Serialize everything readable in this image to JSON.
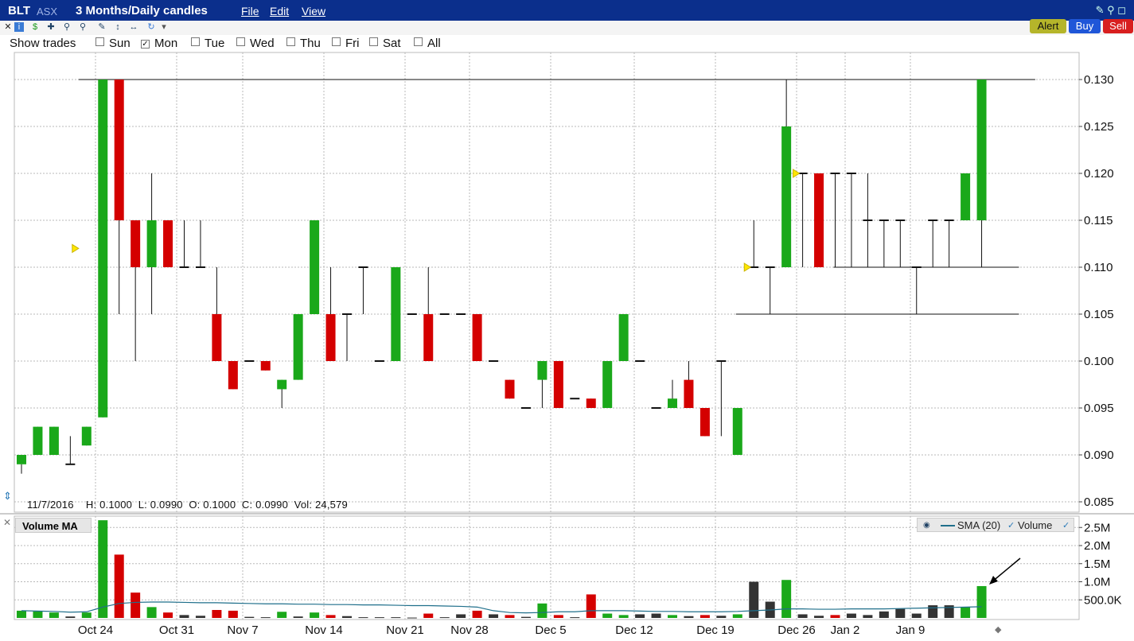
{
  "header": {
    "symbol": "BLT",
    "exchange": "ASX",
    "period": "3 Months/Daily candles",
    "menus": [
      "File",
      "Edit",
      "View"
    ]
  },
  "buttons": {
    "alert": "Alert",
    "buy": "Buy",
    "sell": "Sell"
  },
  "show_trades": {
    "label": "Show trades",
    "days": [
      {
        "label": "Sun",
        "checked": false
      },
      {
        "label": "Mon",
        "checked": true
      },
      {
        "label": "Tue",
        "checked": false
      },
      {
        "label": "Wed",
        "checked": false
      },
      {
        "label": "Thu",
        "checked": false
      },
      {
        "label": "Fri",
        "checked": false
      },
      {
        "label": "Sat",
        "checked": false
      },
      {
        "label": "All",
        "checked": false
      }
    ]
  },
  "info_bar": "11/7/2016    H: 0.1000  L: 0.0990  O: 0.1000  C: 0.0990  Vol: 24,579",
  "volume_panel": {
    "title": "Volume MA",
    "legend_sma": "SMA (20)",
    "legend_volume": "Volume"
  },
  "colors": {
    "up": "#1aa81a",
    "down": "#d40000",
    "neutral": "#333333",
    "sma": "#1f6f8b",
    "header": "#0b2f8c"
  },
  "chart_data": {
    "type": "candlestick",
    "x_labels": [
      "Oct 24",
      "Oct 31",
      "Nov 7",
      "Nov 14",
      "Nov 21",
      "Nov 28",
      "Dec 5",
      "Dec 12",
      "Dec 19",
      "Dec 26",
      "Jan 2",
      "Jan 9"
    ],
    "y_ticks": [
      "0.130",
      "0.125",
      "0.120",
      "0.115",
      "0.110",
      "0.105",
      "0.100",
      "0.095",
      "0.090",
      "0.085"
    ],
    "ylim": [
      0.085,
      0.13
    ],
    "volume_ticks": [
      "2.5M",
      "2.0M",
      "1.5M",
      "1.0M",
      "500.0K"
    ],
    "volume_ylim": [
      0,
      2.7
    ],
    "candles": [
      {
        "o": 0.089,
        "h": 0.089,
        "l": 0.088,
        "c": 0.09,
        "v": 0.2
      },
      {
        "o": 0.09,
        "h": 0.093,
        "l": 0.09,
        "c": 0.093,
        "v": 0.18
      },
      {
        "o": 0.09,
        "h": 0.093,
        "l": 0.09,
        "c": 0.093,
        "v": 0.15
      },
      {
        "o": 0.089,
        "h": 0.092,
        "l": 0.089,
        "c": 0.089,
        "v": 0.04
      },
      {
        "o": 0.091,
        "h": 0.093,
        "l": 0.091,
        "c": 0.093,
        "v": 0.15
      },
      {
        "o": 0.094,
        "h": 0.13,
        "l": 0.094,
        "c": 0.13,
        "v": 2.7
      },
      {
        "o": 0.13,
        "h": 0.13,
        "l": 0.105,
        "c": 0.115,
        "v": 1.75
      },
      {
        "o": 0.115,
        "h": 0.115,
        "l": 0.1,
        "c": 0.11,
        "v": 0.7
      },
      {
        "o": 0.11,
        "h": 0.12,
        "l": 0.105,
        "c": 0.115,
        "v": 0.3
      },
      {
        "o": 0.115,
        "h": 0.115,
        "l": 0.11,
        "c": 0.11,
        "v": 0.15
      },
      {
        "o": 0.11,
        "h": 0.115,
        "l": 0.11,
        "c": 0.11,
        "v": 0.08
      },
      {
        "o": 0.11,
        "h": 0.115,
        "l": 0.11,
        "c": 0.11,
        "v": 0.06
      },
      {
        "o": 0.105,
        "h": 0.11,
        "l": 0.1,
        "c": 0.1,
        "v": 0.22
      },
      {
        "o": 0.1,
        "h": 0.1,
        "l": 0.097,
        "c": 0.097,
        "v": 0.2
      },
      {
        "o": 0.1,
        "h": 0.1,
        "l": 0.1,
        "c": 0.1,
        "v": 0.03
      },
      {
        "o": 0.1,
        "h": 0.1,
        "l": 0.099,
        "c": 0.099,
        "v": 0.02
      },
      {
        "o": 0.097,
        "h": 0.098,
        "l": 0.095,
        "c": 0.098,
        "v": 0.17
      },
      {
        "o": 0.098,
        "h": 0.105,
        "l": 0.098,
        "c": 0.105,
        "v": 0.04
      },
      {
        "o": 0.105,
        "h": 0.115,
        "l": 0.105,
        "c": 0.115,
        "v": 0.15
      },
      {
        "o": 0.105,
        "h": 0.11,
        "l": 0.1,
        "c": 0.1,
        "v": 0.08
      },
      {
        "o": 0.105,
        "h": 0.105,
        "l": 0.1,
        "c": 0.105,
        "v": 0.05
      },
      {
        "o": 0.11,
        "h": 0.11,
        "l": 0.105,
        "c": 0.11,
        "v": 0.02
      },
      {
        "o": 0.1,
        "h": 0.1,
        "l": 0.1,
        "c": 0.1,
        "v": 0.02
      },
      {
        "o": 0.1,
        "h": 0.11,
        "l": 0.1,
        "c": 0.11,
        "v": 0.02
      },
      {
        "o": 0.105,
        "h": 0.105,
        "l": 0.105,
        "c": 0.105,
        "v": 0.01
      },
      {
        "o": 0.105,
        "h": 0.11,
        "l": 0.1,
        "c": 0.1,
        "v": 0.12
      },
      {
        "o": 0.105,
        "h": 0.105,
        "l": 0.105,
        "c": 0.105,
        "v": 0.02
      },
      {
        "o": 0.105,
        "h": 0.105,
        "l": 0.105,
        "c": 0.105,
        "v": 0.1
      },
      {
        "o": 0.105,
        "h": 0.105,
        "l": 0.1,
        "c": 0.1,
        "v": 0.2
      },
      {
        "o": 0.1,
        "h": 0.1,
        "l": 0.1,
        "c": 0.1,
        "v": 0.1
      },
      {
        "o": 0.098,
        "h": 0.098,
        "l": 0.096,
        "c": 0.096,
        "v": 0.08
      },
      {
        "o": 0.095,
        "h": 0.095,
        "l": 0.095,
        "c": 0.095,
        "v": 0.03
      },
      {
        "o": 0.098,
        "h": 0.1,
        "l": 0.095,
        "c": 0.1,
        "v": 0.4
      },
      {
        "o": 0.1,
        "h": 0.1,
        "l": 0.095,
        "c": 0.095,
        "v": 0.08
      },
      {
        "o": 0.096,
        "h": 0.096,
        "l": 0.096,
        "c": 0.096,
        "v": 0.02
      },
      {
        "o": 0.096,
        "h": 0.096,
        "l": 0.095,
        "c": 0.095,
        "v": 0.65
      },
      {
        "o": 0.095,
        "h": 0.1,
        "l": 0.095,
        "c": 0.1,
        "v": 0.12
      },
      {
        "o": 0.1,
        "h": 0.105,
        "l": 0.1,
        "c": 0.105,
        "v": 0.08
      },
      {
        "o": 0.1,
        "h": 0.1,
        "l": 0.1,
        "c": 0.1,
        "v": 0.1
      },
      {
        "o": 0.095,
        "h": 0.095,
        "l": 0.095,
        "c": 0.095,
        "v": 0.12
      },
      {
        "o": 0.095,
        "h": 0.098,
        "l": 0.095,
        "c": 0.096,
        "v": 0.08
      },
      {
        "o": 0.098,
        "h": 0.1,
        "l": 0.095,
        "c": 0.095,
        "v": 0.05
      },
      {
        "o": 0.095,
        "h": 0.095,
        "l": 0.092,
        "c": 0.092,
        "v": 0.08
      },
      {
        "o": 0.1,
        "h": 0.1,
        "l": 0.092,
        "c": 0.1,
        "v": 0.06
      },
      {
        "o": 0.09,
        "h": 0.095,
        "l": 0.09,
        "c": 0.095,
        "v": 0.1
      },
      {
        "o": 0.11,
        "h": 0.115,
        "l": 0.11,
        "c": 0.11,
        "v": 1.0
      },
      {
        "o": 0.11,
        "h": 0.11,
        "l": 0.105,
        "c": 0.11,
        "v": 0.45
      },
      {
        "o": 0.11,
        "h": 0.13,
        "l": 0.11,
        "c": 0.125,
        "v": 1.05
      },
      {
        "o": 0.12,
        "h": 0.12,
        "l": 0.11,
        "c": 0.12,
        "v": 0.1
      },
      {
        "o": 0.12,
        "h": 0.12,
        "l": 0.11,
        "c": 0.11,
        "v": 0.06
      },
      {
        "o": 0.12,
        "h": 0.12,
        "l": 0.11,
        "c": 0.12,
        "v": 0.08
      },
      {
        "o": 0.12,
        "h": 0.12,
        "l": 0.11,
        "c": 0.12,
        "v": 0.12
      },
      {
        "o": 0.115,
        "h": 0.12,
        "l": 0.11,
        "c": 0.115,
        "v": 0.08
      },
      {
        "o": 0.115,
        "h": 0.115,
        "l": 0.11,
        "c": 0.115,
        "v": 0.18
      },
      {
        "o": 0.115,
        "h": 0.115,
        "l": 0.11,
        "c": 0.115,
        "v": 0.25
      },
      {
        "o": 0.11,
        "h": 0.11,
        "l": 0.105,
        "c": 0.11,
        "v": 0.12
      },
      {
        "o": 0.115,
        "h": 0.115,
        "l": 0.11,
        "c": 0.115,
        "v": 0.35
      },
      {
        "o": 0.115,
        "h": 0.115,
        "l": 0.11,
        "c": 0.115,
        "v": 0.35
      },
      {
        "o": 0.115,
        "h": 0.12,
        "l": 0.115,
        "c": 0.12,
        "v": 0.3
      },
      {
        "o": 0.115,
        "h": 0.13,
        "l": 0.11,
        "c": 0.13,
        "v": 0.88
      }
    ],
    "volume_colors": [
      "up",
      "up",
      "up",
      "neutral",
      "up",
      "up",
      "down",
      "down",
      "up",
      "down",
      "neutral",
      "neutral",
      "down",
      "down",
      "neutral",
      "neutral",
      "up",
      "neutral",
      "up",
      "down",
      "neutral",
      "neutral",
      "neutral",
      "neutral",
      "neutral",
      "down",
      "neutral",
      "neutral",
      "down",
      "neutral",
      "down",
      "neutral",
      "up",
      "down",
      "neutral",
      "down",
      "up",
      "up",
      "neutral",
      "neutral",
      "up",
      "neutral",
      "down",
      "neutral",
      "up",
      "neutral",
      "neutral",
      "up",
      "neutral",
      "neutral",
      "down",
      "neutral",
      "neutral",
      "neutral",
      "neutral",
      "neutral",
      "neutral",
      "neutral",
      "up",
      "up"
    ],
    "sma20": [
      0.2,
      0.19,
      0.18,
      0.16,
      0.17,
      0.3,
      0.4,
      0.43,
      0.44,
      0.44,
      0.43,
      0.42,
      0.42,
      0.41,
      0.4,
      0.39,
      0.39,
      0.38,
      0.38,
      0.37,
      0.37,
      0.36,
      0.36,
      0.35,
      0.34,
      0.34,
      0.33,
      0.32,
      0.3,
      0.2,
      0.15,
      0.14,
      0.15,
      0.17,
      0.17,
      0.2,
      0.2,
      0.2,
      0.19,
      0.18,
      0.18,
      0.17,
      0.17,
      0.17,
      0.18,
      0.2,
      0.22,
      0.25,
      0.25,
      0.24,
      0.24,
      0.25,
      0.25,
      0.25,
      0.26,
      0.27,
      0.28,
      0.29,
      0.3,
      0.31
    ],
    "trend_lines": [
      {
        "from_index": 4,
        "to_index": 62,
        "price": 0.13
      },
      {
        "from_index": 50,
        "to_index": 61,
        "price": 0.11
      },
      {
        "from_index": 44,
        "to_index": 61,
        "price": 0.105
      }
    ],
    "trade_markers": [
      {
        "index": 4,
        "price": 0.112
      },
      {
        "index": 45,
        "price": 0.11
      },
      {
        "index": 48,
        "price": 0.12
      }
    ]
  }
}
